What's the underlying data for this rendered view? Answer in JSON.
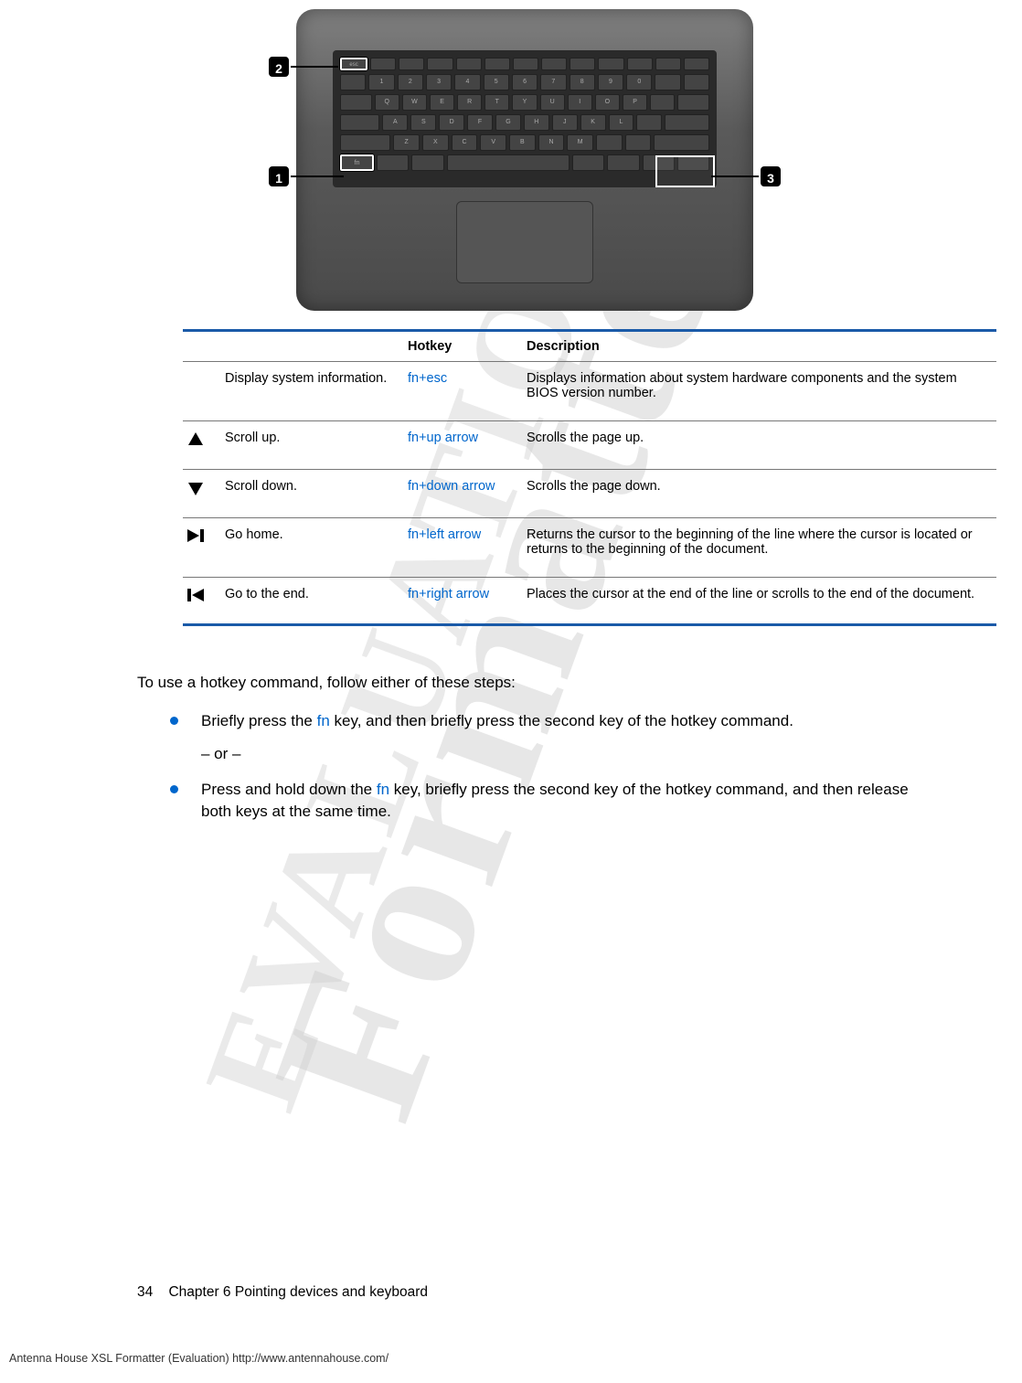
{
  "watermark": {
    "line1": "Formatter",
    "line2": "EVALUATION"
  },
  "diagram": {
    "callouts": [
      "1",
      "2",
      "3"
    ]
  },
  "table": {
    "headers": {
      "hotkey": "Hotkey",
      "description": "Description"
    },
    "rows": [
      {
        "name": "Display system information.",
        "hotkey": "fn+esc",
        "description": "Displays information about system hardware components and the system BIOS version number.",
        "icon": ""
      },
      {
        "name": "Scroll up.",
        "hotkey": "fn+up arrow",
        "description": "Scrolls the page up.",
        "icon": "arrow-up"
      },
      {
        "name": "Scroll down.",
        "hotkey": "fn+down arrow",
        "description": "Scrolls the page down.",
        "icon": "arrow-down"
      },
      {
        "name": "Go home.",
        "hotkey": "fn+left arrow",
        "description": "Returns the cursor to the beginning of the line where the cursor is located or returns to the beginning of the document.",
        "icon": "home"
      },
      {
        "name": "Go to the end.",
        "hotkey": "fn+right arrow",
        "description": "Places the cursor at the end of the line or scrolls to the end of the document.",
        "icon": "end"
      }
    ]
  },
  "instructions": {
    "intro": "To use a hotkey command, follow either of these steps:",
    "fn_label": "fn",
    "step1_a": "Briefly press the ",
    "step1_b": " key, and then briefly press the second key of the hotkey command.",
    "or": "– or –",
    "step2_a": "Press and hold down the ",
    "step2_b": " key, briefly press the second key of the hotkey command, and then release both keys at the same time."
  },
  "footer": {
    "page": "34",
    "chapter": "Chapter 6   Pointing devices and keyboard",
    "note": "Antenna House XSL Formatter (Evaluation)  http://www.antennahouse.com/"
  }
}
